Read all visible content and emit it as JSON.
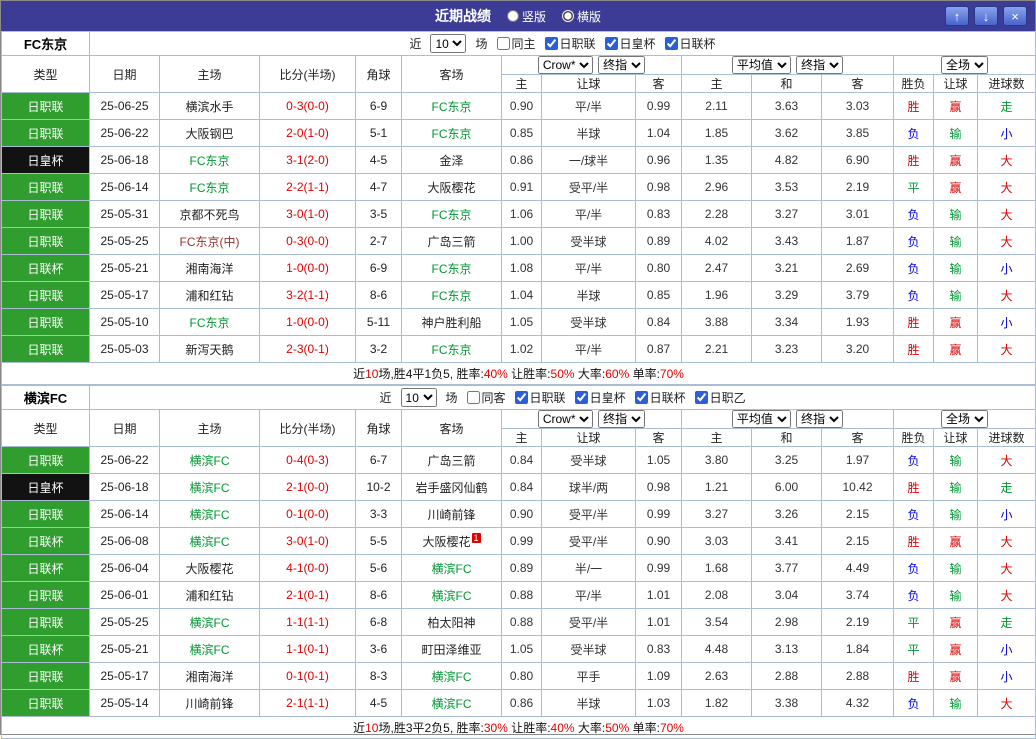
{
  "titlebar": {
    "title": "近期战绩",
    "radios": [
      {
        "label": "竖版",
        "selected": false
      },
      {
        "label": "横版",
        "selected": true
      }
    ],
    "buttons": {
      "up": "↑",
      "down": "↓",
      "close": "×"
    }
  },
  "filter_labels": {
    "near": "近",
    "count": "10",
    "games": "场"
  },
  "table_header": {
    "type": "类型",
    "date": "日期",
    "home": "主场",
    "score": "比分(半场)",
    "corner": "角球",
    "away": "客场",
    "asia": {
      "home": "主",
      "handicap": "让球",
      "away": "客"
    },
    "euro": {
      "home": "主",
      "draw": "和",
      "away": "客"
    },
    "result": {
      "outcome": "胜负",
      "handicap": "让球",
      "goals": "进球数"
    }
  },
  "dropdowns": {
    "bookmaker": "Crow*",
    "final_a": "终指",
    "average": "平均值",
    "final_b": "终指",
    "scope": "全场"
  },
  "colors": {
    "titlebar_bg": "#3c3c96",
    "type_league_bg": "#2f9e2f",
    "type_cup_bg": "#121212",
    "self_team": "#009933",
    "neutral_team": "#993333",
    "score": "#e00000",
    "win": "#e00000",
    "draw": "#009933",
    "lose": "#0000e0",
    "handicap_win": "#e00000",
    "handicap_lose": "#009933",
    "goals_big": "#e00000",
    "goals_small": "#0000e0",
    "goals_push": "#009933"
  },
  "sections": [
    {
      "team": "FC东京",
      "same_label": "同主",
      "leagues": [
        "日职联",
        "日皇杯",
        "日联杯"
      ],
      "rows": [
        [
          "日职联",
          "25-06-25",
          "横滨水手",
          "0-3(0-0)",
          "6-9",
          "FC东京",
          "0.90",
          "平/半",
          "0.99",
          "2.11",
          "3.63",
          "3.03",
          "胜",
          "赢",
          "走"
        ],
        [
          "日职联",
          "25-06-22",
          "大阪钢巴",
          "2-0(1-0)",
          "5-1",
          "FC东京",
          "0.85",
          "半球",
          "1.04",
          "1.85",
          "3.62",
          "3.85",
          "负",
          "输",
          "小"
        ],
        [
          "日皇杯",
          "25-06-18",
          "FC东京",
          "3-1(2-0)",
          "4-5",
          "金泽",
          "0.86",
          "一/球半",
          "0.96",
          "1.35",
          "4.82",
          "6.90",
          "胜",
          "赢",
          "大"
        ],
        [
          "日职联",
          "25-06-14",
          "FC东京",
          "2-2(1-1)",
          "4-7",
          "大阪樱花",
          "0.91",
          "受平/半",
          "0.98",
          "2.96",
          "3.53",
          "2.19",
          "平",
          "赢",
          "大"
        ],
        [
          "日职联",
          "25-05-31",
          "京都不死鸟",
          "3-0(1-0)",
          "3-5",
          "FC东京",
          "1.06",
          "平/半",
          "0.83",
          "2.28",
          "3.27",
          "3.01",
          "负",
          "输",
          "大"
        ],
        [
          "日职联",
          "25-05-25",
          "FC东京(中)",
          "0-3(0-0)",
          "2-7",
          "广岛三箭",
          "1.00",
          "受半球",
          "0.89",
          "4.02",
          "3.43",
          "1.87",
          "负",
          "输",
          "大"
        ],
        [
          "日联杯",
          "25-05-21",
          "湘南海洋",
          "1-0(0-0)",
          "6-9",
          "FC东京",
          "1.08",
          "平/半",
          "0.80",
          "2.47",
          "3.21",
          "2.69",
          "负",
          "输",
          "小"
        ],
        [
          "日职联",
          "25-05-17",
          "浦和红钻",
          "3-2(1-1)",
          "8-6",
          "FC东京",
          "1.04",
          "半球",
          "0.85",
          "1.96",
          "3.29",
          "3.79",
          "负",
          "输",
          "大"
        ],
        [
          "日职联",
          "25-05-10",
          "FC东京",
          "1-0(0-0)",
          "5-11",
          "神户胜利船",
          "1.05",
          "受半球",
          "0.84",
          "3.88",
          "3.34",
          "1.93",
          "胜",
          "赢",
          "小"
        ],
        [
          "日职联",
          "25-05-03",
          "新泻天鹅",
          "2-3(0-1)",
          "3-2",
          "FC东京",
          "1.02",
          "平/半",
          "0.87",
          "2.21",
          "3.23",
          "3.20",
          "胜",
          "赢",
          "大"
        ]
      ],
      "badges": [],
      "footer": [
        {
          "text": "近"
        },
        {
          "text": "10",
          "red": true
        },
        {
          "text": "场,胜4平1负5, 胜率:"
        },
        {
          "text": "40%",
          "red": true
        },
        {
          "text": " 让胜率:"
        },
        {
          "text": "50%",
          "red": true
        },
        {
          "text": " 大率:"
        },
        {
          "text": "60%",
          "red": true
        },
        {
          "text": " 单率:"
        },
        {
          "text": "70%",
          "red": true
        }
      ]
    },
    {
      "team": "横滨FC",
      "same_label": "同客",
      "leagues": [
        "日职联",
        "日皇杯",
        "日联杯",
        "日职乙"
      ],
      "rows": [
        [
          "日职联",
          "25-06-22",
          "横滨FC",
          "0-4(0-3)",
          "6-7",
          "广岛三箭",
          "0.84",
          "受半球",
          "1.05",
          "3.80",
          "3.25",
          "1.97",
          "负",
          "输",
          "大"
        ],
        [
          "日皇杯",
          "25-06-18",
          "横滨FC",
          "2-1(0-0)",
          "10-2",
          "岩手盛冈仙鹤",
          "0.84",
          "球半/两",
          "0.98",
          "1.21",
          "6.00",
          "10.42",
          "胜",
          "输",
          "走"
        ],
        [
          "日职联",
          "25-06-14",
          "横滨FC",
          "0-1(0-0)",
          "3-3",
          "川崎前锋",
          "0.90",
          "受平/半",
          "0.99",
          "3.27",
          "3.26",
          "2.15",
          "负",
          "输",
          "小"
        ],
        [
          "日联杯",
          "25-06-08",
          "横滨FC",
          "3-0(1-0)",
          "5-5",
          "大阪樱花",
          "0.99",
          "受平/半",
          "0.90",
          "3.03",
          "3.41",
          "2.15",
          "胜",
          "赢",
          "大"
        ],
        [
          "日联杯",
          "25-06-04",
          "大阪樱花",
          "4-1(0-0)",
          "5-6",
          "横滨FC",
          "0.89",
          "半/一",
          "0.99",
          "1.68",
          "3.77",
          "4.49",
          "负",
          "输",
          "大"
        ],
        [
          "日职联",
          "25-06-01",
          "浦和红钻",
          "2-1(0-1)",
          "8-6",
          "横滨FC",
          "0.88",
          "平/半",
          "1.01",
          "2.08",
          "3.04",
          "3.74",
          "负",
          "输",
          "大"
        ],
        [
          "日职联",
          "25-05-25",
          "横滨FC",
          "1-1(1-1)",
          "6-8",
          "柏太阳神",
          "0.88",
          "受平/半",
          "1.01",
          "3.54",
          "2.98",
          "2.19",
          "平",
          "赢",
          "走"
        ],
        [
          "日联杯",
          "25-05-21",
          "横滨FC",
          "1-1(0-1)",
          "3-6",
          "町田泽维亚",
          "1.05",
          "受半球",
          "0.83",
          "4.48",
          "3.13",
          "1.84",
          "平",
          "赢",
          "小"
        ],
        [
          "日职联",
          "25-05-17",
          "湘南海洋",
          "0-1(0-1)",
          "8-3",
          "横滨FC",
          "0.80",
          "平手",
          "1.09",
          "2.63",
          "2.88",
          "2.88",
          "胜",
          "赢",
          "小"
        ],
        [
          "日职联",
          "25-05-14",
          "川崎前锋",
          "2-1(1-1)",
          "4-5",
          "横滨FC",
          "0.86",
          "半球",
          "1.03",
          "1.82",
          "3.38",
          "4.32",
          "负",
          "输",
          "大"
        ]
      ],
      "badges": [
        {
          "row": 3,
          "text": "1"
        }
      ],
      "footer": [
        {
          "text": "近"
        },
        {
          "text": "10",
          "red": true
        },
        {
          "text": "场,胜3平2负5, 胜率:"
        },
        {
          "text": "30%",
          "red": true
        },
        {
          "text": " 让胜率:"
        },
        {
          "text": "40%",
          "red": true
        },
        {
          "text": " 大率:"
        },
        {
          "text": "50%",
          "red": true
        },
        {
          "text": " 单率:"
        },
        {
          "text": "70%",
          "red": true
        }
      ]
    }
  ]
}
